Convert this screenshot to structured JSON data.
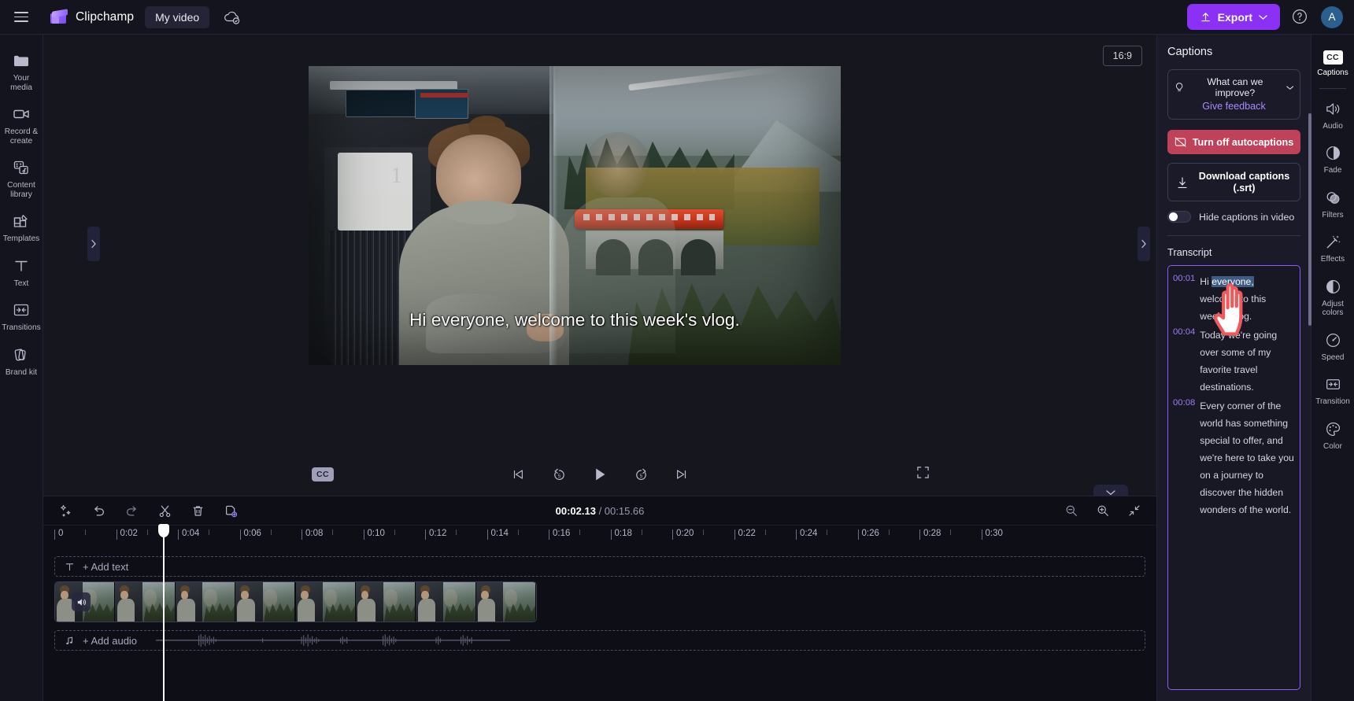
{
  "app": {
    "brand": "Clipchamp",
    "project_title": "My video",
    "save_state_icon": "cloud-saved-icon",
    "menu_icon": "hamburger-menu-icon"
  },
  "header": {
    "export_label": "Export",
    "export_icon": "upload-icon",
    "export_caret_icon": "chevron-down-icon",
    "export_color": "#8b31f5",
    "help_icon": "help-circle-icon",
    "avatar_initial": "A"
  },
  "sidebar": {
    "items": [
      {
        "label": "Your media",
        "icon": "folder-icon"
      },
      {
        "label": "Record & create",
        "icon": "video-camera-icon"
      },
      {
        "label": "Content library",
        "icon": "content-library-icon"
      },
      {
        "label": "Templates",
        "icon": "templates-grid-icon"
      },
      {
        "label": "Text",
        "icon": "text-t-icon"
      },
      {
        "label": "Transitions",
        "icon": "transitions-icon"
      },
      {
        "label": "Brand kit",
        "icon": "brand-kit-icon"
      }
    ]
  },
  "preview": {
    "aspect_ratio": "16:9",
    "caption_text": "Hi everyone, welcome to this week's vlog.",
    "cc_badge": "CC",
    "controls": {
      "skip_start": "skip-to-start-icon",
      "back5": "rewind-5-icon",
      "play": "play-icon",
      "forward5": "forward-5-icon",
      "skip_end": "skip-to-end-icon",
      "fullscreen": "fullscreen-icon"
    }
  },
  "timeline": {
    "tools": [
      {
        "name": "magic-wand-icon"
      },
      {
        "name": "undo-icon"
      },
      {
        "name": "redo-icon"
      },
      {
        "name": "split-scissors-icon"
      },
      {
        "name": "delete-trash-icon"
      },
      {
        "name": "duplicate-icon"
      }
    ],
    "current_time": "00:02.13",
    "total_time": "/ 00:15.66",
    "zoom_out_icon": "zoom-out-icon",
    "zoom_in_icon": "zoom-in-icon",
    "fit_icon": "fit-to-screen-icon",
    "ruler_ticks": [
      "0",
      "0:02",
      "0:04",
      "0:06",
      "0:08",
      "0:10",
      "0:12",
      "0:14",
      "0:16",
      "0:18",
      "0:20",
      "0:22",
      "0:24",
      "0:26",
      "0:28",
      "0:30"
    ],
    "add_text_label": "+ Add text",
    "add_text_icon": "text-t-icon",
    "add_audio_label": "+ Add audio",
    "add_audio_icon": "music-note-icon",
    "clip_mute_icon": "speaker-icon"
  },
  "captions_panel": {
    "title": "Captions",
    "feedback_question": "What can we improve?",
    "feedback_icon": "lightbulb-icon",
    "feedback_caret_icon": "chevron-down-icon",
    "feedback_link": "Give feedback",
    "turn_off_label": "Turn off autocaptions",
    "turn_off_icon": "captions-off-icon",
    "turn_off_color": "#c0425a",
    "download_label": "Download captions (.srt)",
    "download_icon": "download-arrow-icon",
    "hide_captions_label": "Hide captions in video",
    "hide_captions_on": false,
    "transcript_heading": "Transcript",
    "transcript": [
      {
        "time": "00:01",
        "text": "Hi everyone, welcome to this week's vlog.",
        "highlight": "everyone,"
      },
      {
        "time": "00:04",
        "text": "Today we're going over some of my favorite travel destinations."
      },
      {
        "time": "00:08",
        "text": "Every corner of the world has something special to offer, and we're here to take you on a journey to discover the hidden wonders of the world."
      }
    ],
    "accent_border": "#8b5cf6",
    "cursor_icon": "pointing-hand-cursor"
  },
  "right_rail": {
    "items": [
      {
        "label": "Captions",
        "icon": "cc-icon",
        "active": true
      },
      {
        "label": "Audio",
        "icon": "speaker-icon"
      },
      {
        "label": "Fade",
        "icon": "fade-circle-icon"
      },
      {
        "label": "Filters",
        "icon": "filters-overlap-icon"
      },
      {
        "label": "Effects",
        "icon": "effects-wand-icon"
      },
      {
        "label": "Adjust colors",
        "icon": "adjust-colors-icon"
      },
      {
        "label": "Speed",
        "icon": "speedometer-icon"
      },
      {
        "label": "Transition",
        "icon": "transitions-icon"
      },
      {
        "label": "Color",
        "icon": "color-palette-icon"
      }
    ]
  }
}
